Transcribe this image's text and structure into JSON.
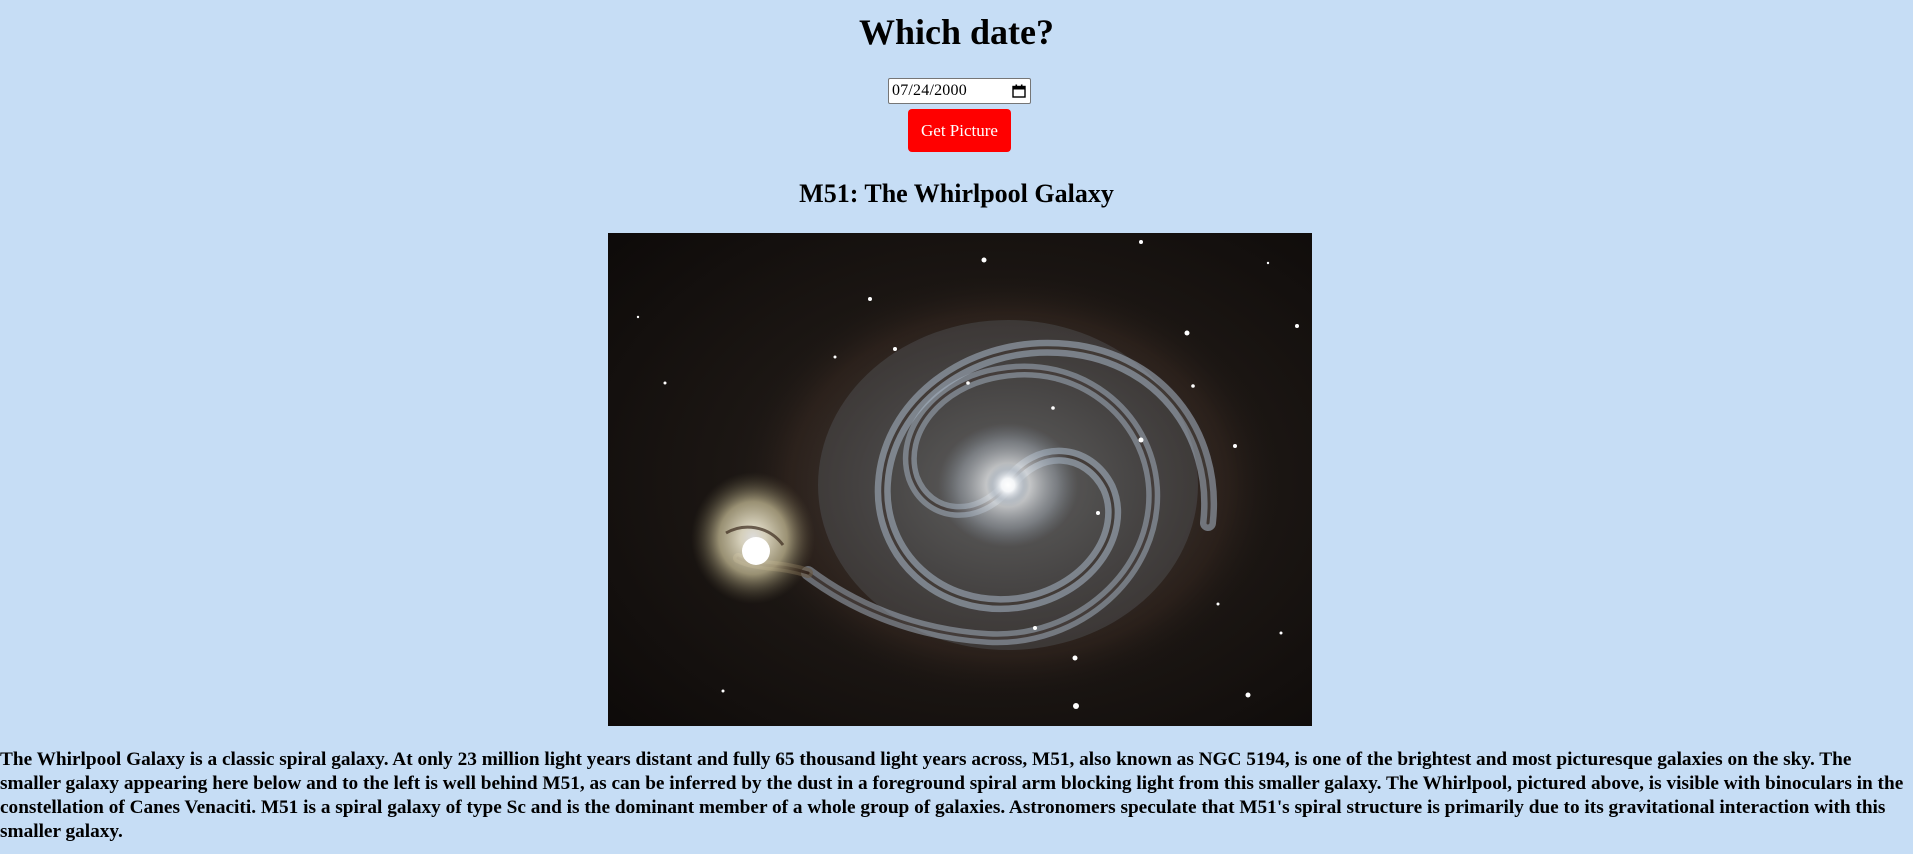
{
  "header": {
    "title": "Which date?"
  },
  "date_picker": {
    "value": "07/24/2000"
  },
  "get_button": {
    "label": "Get Picture",
    "color": "#ff0000"
  },
  "picture": {
    "title": "M51: The Whirlpool Galaxy",
    "explanation": "The Whirlpool Galaxy is a classic spiral galaxy. At only 23 million light years distant and fully 65 thousand light years across, M51, also known as NGC 5194, is one of the brightest and most picturesque galaxies on the sky. The smaller galaxy appearing here below and to the left is well behind M51, as can be inferred by the dust in a foreground spiral arm blocking light from this smaller galaxy. The Whirlpool, pictured above, is visible with binoculars in the constellation of Canes Venaciti. M51 is a spiral galaxy of type Sc and is the dominant member of a whole group of galaxies. Astronomers speculate that M51's spiral structure is primarily due to its gravitational interaction with this smaller galaxy."
  },
  "colors": {
    "background": "#c6ddf5",
    "button": "#ff0000",
    "button_text": "#ffffff"
  }
}
